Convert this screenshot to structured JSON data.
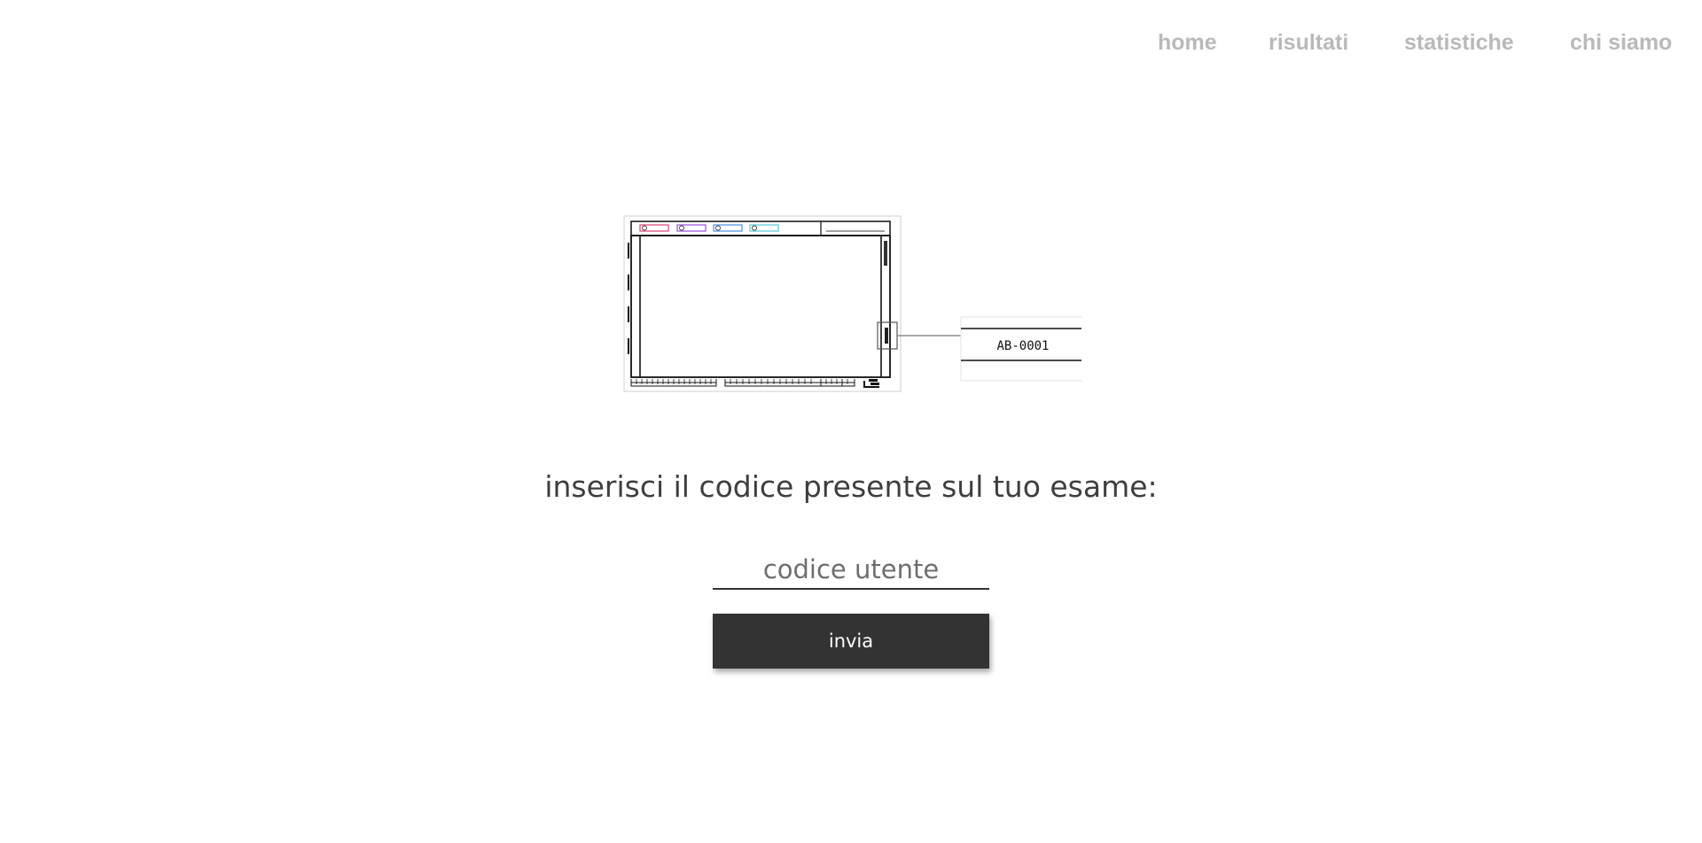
{
  "nav": {
    "home": "home",
    "risultati": "risultati",
    "statistiche": "statistiche",
    "chi_siamo": "chi siamo"
  },
  "illustration": {
    "code_label": "AB-0001"
  },
  "form": {
    "prompt": "inserisci il codice presente sul tuo esame:",
    "input_placeholder": "codice utente",
    "submit_label": "invia"
  },
  "colors": {
    "nav_text": "#b9b9b9",
    "prompt_text": "#3e3e3e",
    "button_bg": "#333333",
    "button_text": "#ffffff",
    "tab_red": "#e0427a",
    "tab_purple": "#9a4fd8",
    "tab_blue": "#4a8fe0",
    "tab_cyan": "#5ec8d8"
  }
}
